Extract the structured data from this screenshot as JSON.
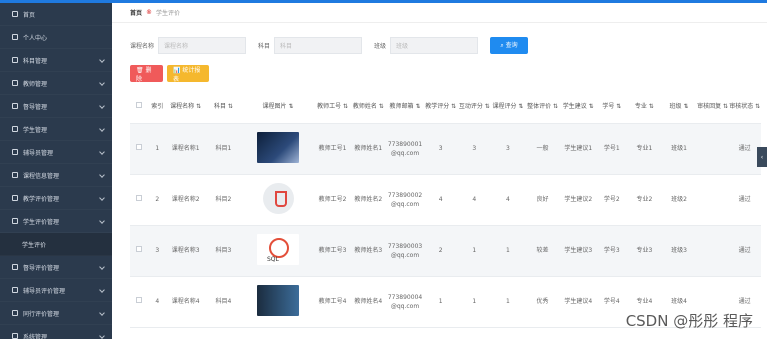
{
  "sidebar": {
    "items": [
      {
        "label": "首页",
        "icon": "home-icon"
      },
      {
        "label": "个人中心",
        "icon": "user-icon"
      },
      {
        "label": "科目管理",
        "icon": "book-icon"
      },
      {
        "label": "教师管理",
        "icon": "teacher-icon"
      },
      {
        "label": "督导管理",
        "icon": "supervisor-icon"
      },
      {
        "label": "学生管理",
        "icon": "student-icon"
      },
      {
        "label": "辅导员管理",
        "icon": "counselor-icon"
      },
      {
        "label": "课程信息管理",
        "icon": "course-icon"
      },
      {
        "label": "教学评价管理",
        "icon": "evaluation-icon"
      },
      {
        "label": "学生评价管理",
        "icon": "student-eval-icon"
      },
      {
        "label": "学生评价",
        "icon": ""
      },
      {
        "label": "督导评价管理",
        "icon": "supervisor-eval-icon"
      },
      {
        "label": "辅导员评价管理",
        "icon": "counselor-eval-icon"
      },
      {
        "label": "同行评价管理",
        "icon": "peer-eval-icon"
      },
      {
        "label": "系统管理",
        "icon": "settings-icon"
      }
    ]
  },
  "breadcrumb": {
    "home": "首页",
    "sep": "®",
    "current": "学生评价"
  },
  "search": {
    "course_label": "课程名称",
    "course_placeholder": "课程名称",
    "subject_label": "科目",
    "subject_placeholder": "科目",
    "class_label": "班级",
    "class_placeholder": "班级",
    "query_button": "⌕ 查询"
  },
  "actions": {
    "delete_button": "🗑 删除",
    "stats_button": "📊 统计报表"
  },
  "table": {
    "headers": [
      "索引",
      "课程名称 ⇅",
      "科目 ⇅",
      "课程图片 ⇅",
      "教师工号 ⇅",
      "教师姓名 ⇅",
      "教师邮箱 ⇅",
      "教学评分 ⇅",
      "互动评分 ⇅",
      "课程评分 ⇅",
      "整体评价 ⇅",
      "学生建议 ⇅",
      "学号 ⇅",
      "专业 ⇅",
      "班级 ⇅",
      "审核回复 ⇅",
      "审核状态 ⇅"
    ],
    "rows": [
      {
        "idx": "1",
        "course": "课程名称1",
        "subject": "科目1",
        "img": "t1",
        "tid": "教师工号1",
        "tname": "教师姓名1",
        "email": "773890001@qq.com",
        "teach": "3",
        "interact": "3",
        "score": "3",
        "overall": "一般",
        "advice": "学生建议1",
        "sid": "学号1",
        "major": "专业1",
        "cls": "班级1",
        "reply": "",
        "status": "通过"
      },
      {
        "idx": "2",
        "course": "课程名称2",
        "subject": "科目2",
        "img": "t2",
        "tid": "教师工号2",
        "tname": "教师姓名2",
        "email": "773890002@qq.com",
        "teach": "4",
        "interact": "4",
        "score": "4",
        "overall": "良好",
        "advice": "学生建议2",
        "sid": "学号2",
        "major": "专业2",
        "cls": "班级2",
        "reply": "",
        "status": "通过"
      },
      {
        "idx": "3",
        "course": "课程名称3",
        "subject": "科目3",
        "img": "t3",
        "tid": "教师工号3",
        "tname": "教师姓名3",
        "email": "773890003@qq.com",
        "teach": "2",
        "interact": "1",
        "score": "1",
        "overall": "较差",
        "advice": "学生建议3",
        "sid": "学号3",
        "major": "专业3",
        "cls": "班级3",
        "reply": "",
        "status": "通过"
      },
      {
        "idx": "4",
        "course": "课程名称4",
        "subject": "科目4",
        "img": "t4",
        "tid": "教师工号4",
        "tname": "教师姓名4",
        "email": "773890004@qq.com",
        "teach": "1",
        "interact": "1",
        "score": "1",
        "overall": "优秀",
        "advice": "学生建议4",
        "sid": "学号4",
        "major": "专业4",
        "cls": "班级4",
        "reply": "",
        "status": "通过"
      }
    ]
  },
  "watermark": "CSDN @彤彤 程序"
}
